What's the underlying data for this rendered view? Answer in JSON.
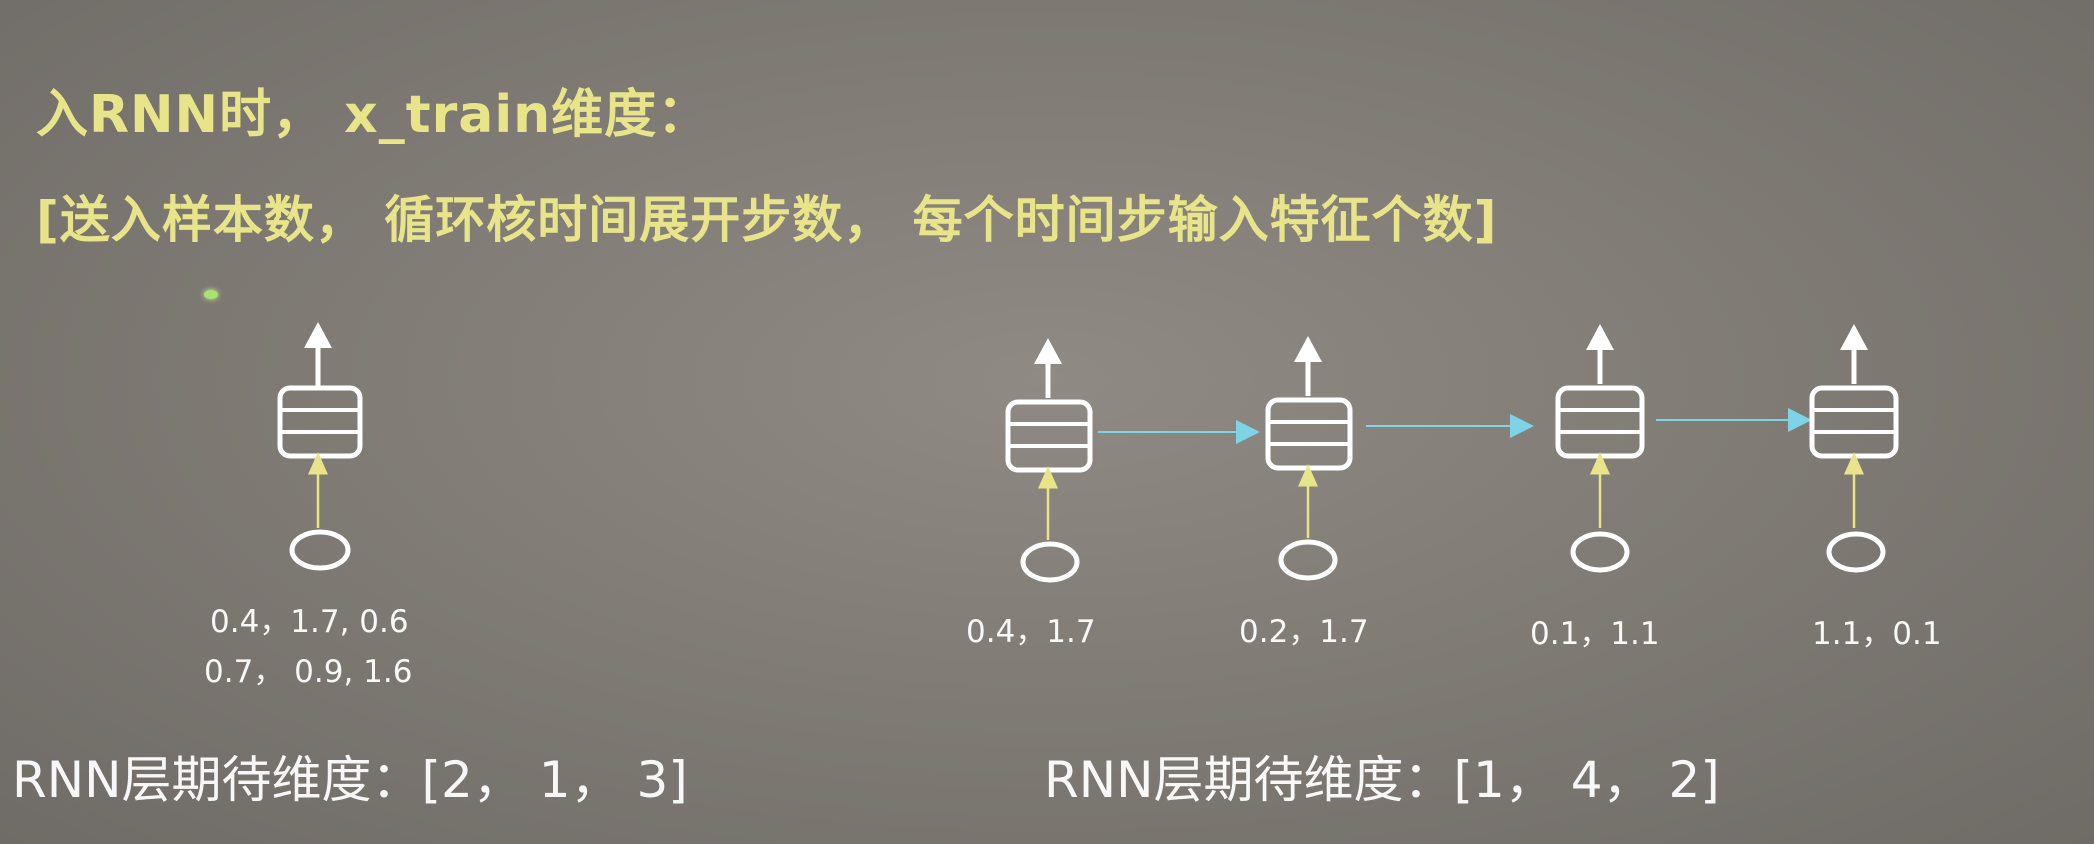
{
  "title": {
    "line1": "入RNN时， x_train维度：",
    "line2": "[送入样本数， 循环核时间展开步数， 每个时间步输入特征个数]"
  },
  "left_example": {
    "values_line1": "0.4，1.7, 0.6",
    "values_line2": "0.7， 0.9, 1.6",
    "dims_label": "RNN层期待维度：[2， 1， 3]"
  },
  "right_example": {
    "step_values": [
      "0.4，1.7",
      "0.2，1.7",
      "0.1，1.1",
      "1.1，0.1"
    ],
    "dims_label": "RNN层期待维度：[1， 4， 2]"
  },
  "colors": {
    "title_text": "#e8e48a",
    "input_arrow": "#e8e48a",
    "recurrent_arrow": "#7fd3e6",
    "cell_stroke": "#ffffff"
  }
}
